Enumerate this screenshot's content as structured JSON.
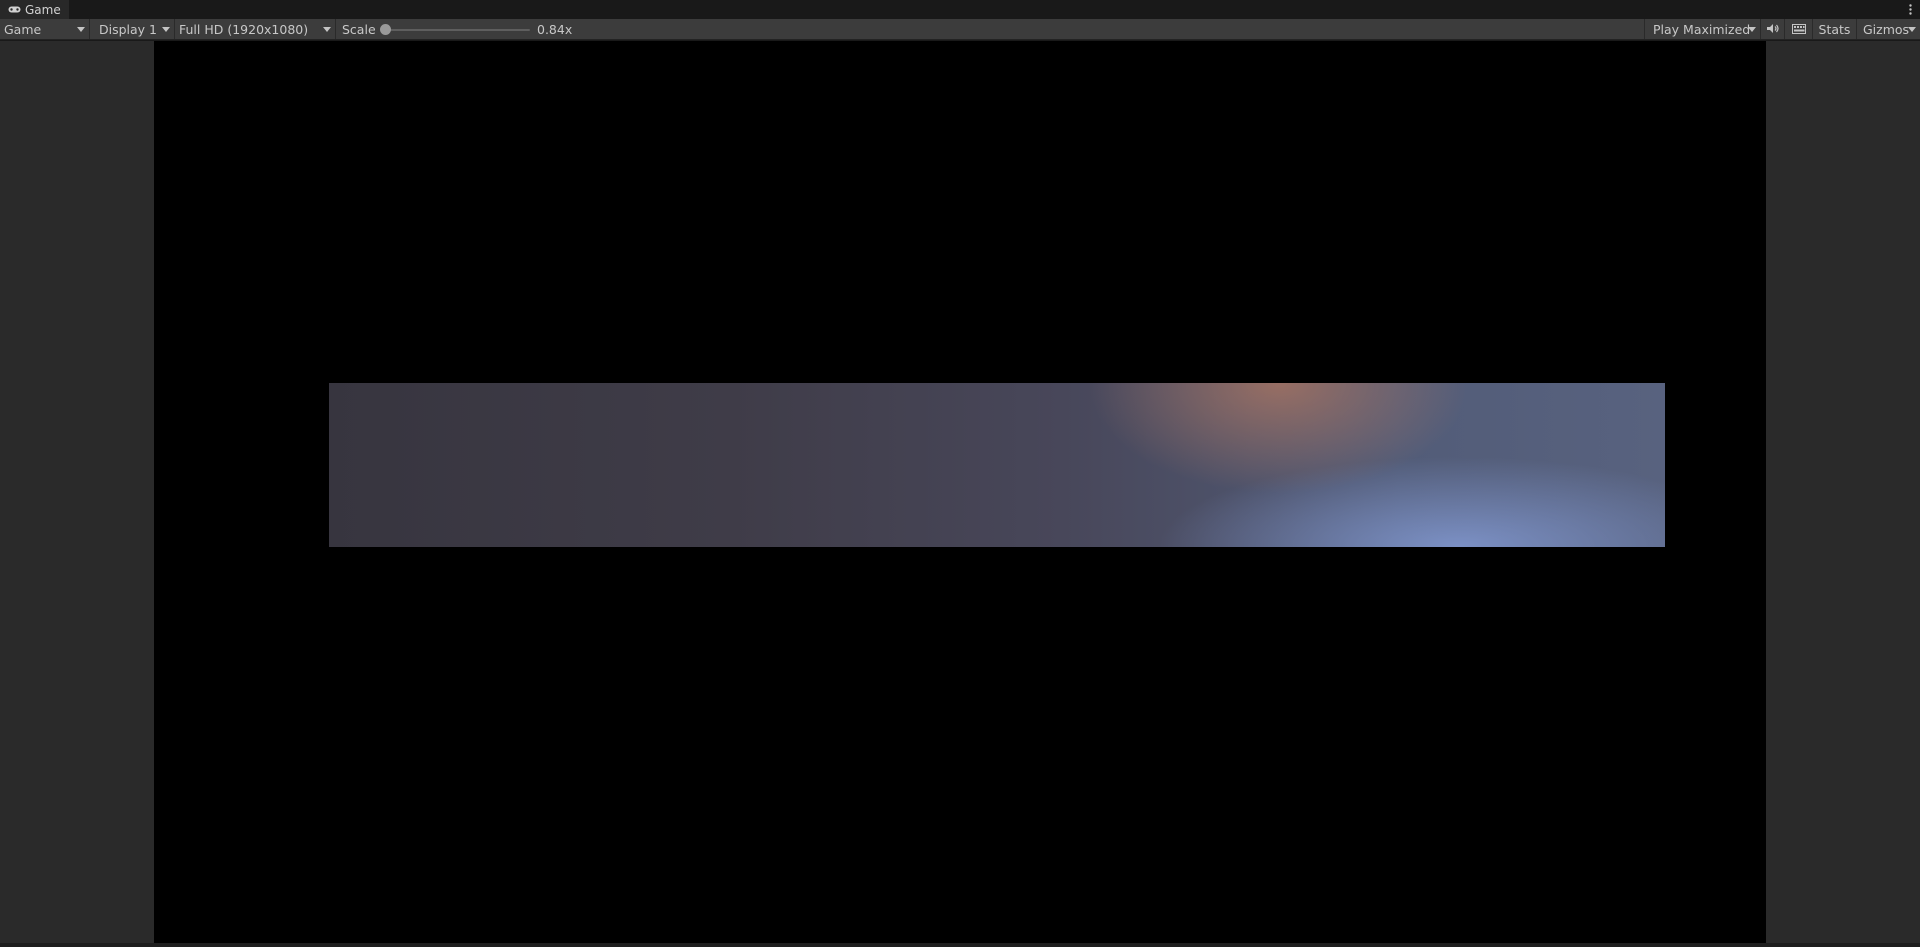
{
  "window": {
    "tab_title": "Game",
    "tab_icon": "gamepad-icon",
    "menu_icon": "kebab-menu-icon"
  },
  "toolbar": {
    "view_mode": "Game",
    "display": "Display 1",
    "resolution": "Full HD (1920x1080)",
    "scale_label": "Scale",
    "scale_value": "0.84x",
    "play_mode": "Play Maximized",
    "audio_icon": "speaker-icon",
    "keyboard_icon": "keyboard-icon",
    "stats_label": "Stats",
    "gizmos_label": "Gizmos"
  },
  "colors": {
    "background": "#191919",
    "toolbar": "#3c3c3c",
    "letterbox": "#2a2a2a",
    "game_view": "#000000",
    "sky_warm": "#a5735e",
    "sky_cool": "#8096cd"
  }
}
